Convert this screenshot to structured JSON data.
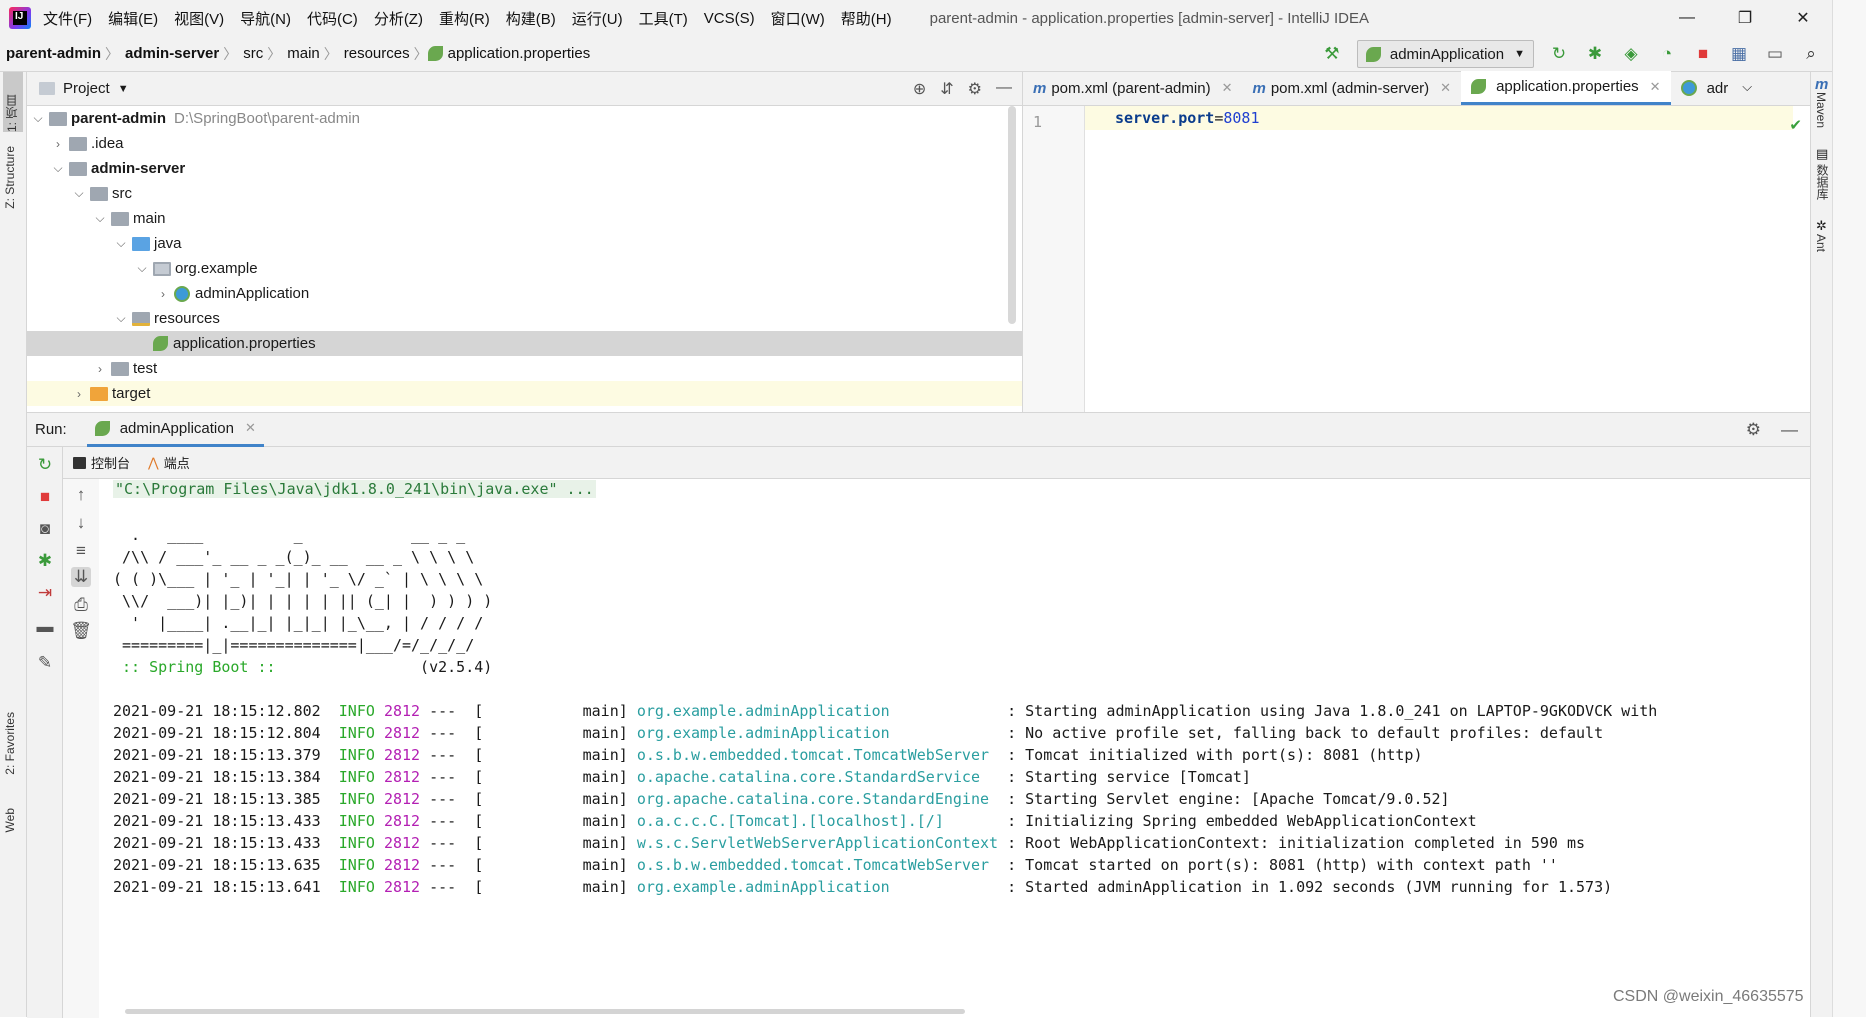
{
  "app": {
    "logo_text": "IJ",
    "menu": [
      "文件(F)",
      "编辑(E)",
      "视图(V)",
      "导航(N)",
      "代码(C)",
      "分析(Z)",
      "重构(R)",
      "构建(B)",
      "运行(U)",
      "工具(T)",
      "VCS(S)",
      "窗口(W)",
      "帮助(H)"
    ],
    "title": "parent-admin - application.properties [admin-server] - IntelliJ IDEA"
  },
  "breadcrumb": [
    "parent-admin",
    "admin-server",
    "src",
    "main",
    "resources",
    "application.properties"
  ],
  "run_config": "adminApplication",
  "left_strip": {
    "project_tab": "1: 项目",
    "structure_tab": "Z: Structure",
    "favorites_tab": "2: Favorites",
    "web_tab": "Web"
  },
  "right_strip": {
    "maven": "Maven",
    "database": "数据库",
    "ant": "Ant"
  },
  "project": {
    "header": "Project",
    "tree": [
      {
        "label": "parent-admin",
        "extra": "D:\\SpringBoot\\parent-admin",
        "bold": true
      },
      {
        "label": ".idea"
      },
      {
        "label": "admin-server",
        "bold": true
      },
      {
        "label": "src"
      },
      {
        "label": "main"
      },
      {
        "label": "java"
      },
      {
        "label": "org.example"
      },
      {
        "label": "adminApplication"
      },
      {
        "label": "resources"
      },
      {
        "label": "application.properties"
      },
      {
        "label": "test"
      },
      {
        "label": "target"
      }
    ]
  },
  "editor": {
    "tabs": [
      "pom.xml (parent-admin)",
      "pom.xml (admin-server)",
      "application.properties",
      "adr"
    ],
    "line_number": "1",
    "code": {
      "key": "server.port",
      "eq": "=",
      "value": "8081"
    }
  },
  "run": {
    "label": "Run:",
    "tab": "adminApplication",
    "subtabs": [
      "控制台",
      "端点"
    ],
    "command": "\"C:\\Program Files\\Java\\jdk1.8.0_241\\bin\\java.exe\" ...",
    "banner": [
      "  .   ____          _            __ _ _",
      " /\\\\ / ___'_ __ _ _(_)_ __  __ _ \\ \\ \\ \\",
      "( ( )\\___ | '_ | '_| | '_ \\/ _` | \\ \\ \\ \\",
      " \\\\/  ___)| |_)| | | | | || (_| |  ) ) ) )",
      "  '  |____| .__|_| |_|_| |_\\__, | / / / /",
      " =========|_|==============|___/=/_/_/_/"
    ],
    "spring_label": " :: Spring Boot :: ",
    "spring_version": "               (v2.5.4)",
    "logs": [
      {
        "ts": "2021-09-21 18:15:12.802",
        "level": "INFO",
        "pid": "2812",
        "thread": "---  [           main]",
        "logger": "org.example.adminApplication            ",
        "msg": ": Starting adminApplication using Java 1.8.0_241 on LAPTOP-9GKODVCK with"
      },
      {
        "ts": "2021-09-21 18:15:12.804",
        "level": "INFO",
        "pid": "2812",
        "thread": "---  [           main]",
        "logger": "org.example.adminApplication            ",
        "msg": ": No active profile set, falling back to default profiles: default"
      },
      {
        "ts": "2021-09-21 18:15:13.379",
        "level": "INFO",
        "pid": "2812",
        "thread": "---  [           main]",
        "logger": "o.s.b.w.embedded.tomcat.TomcatWebServer ",
        "msg": ": Tomcat initialized with port(s): 8081 (http)"
      },
      {
        "ts": "2021-09-21 18:15:13.384",
        "level": "INFO",
        "pid": "2812",
        "thread": "---  [           main]",
        "logger": "o.apache.catalina.core.StandardService  ",
        "msg": ": Starting service [Tomcat]"
      },
      {
        "ts": "2021-09-21 18:15:13.385",
        "level": "INFO",
        "pid": "2812",
        "thread": "---  [           main]",
        "logger": "org.apache.catalina.core.StandardEngine ",
        "msg": ": Starting Servlet engine: [Apache Tomcat/9.0.52]"
      },
      {
        "ts": "2021-09-21 18:15:13.433",
        "level": "INFO",
        "pid": "2812",
        "thread": "---  [           main]",
        "logger": "o.a.c.c.C.[Tomcat].[localhost].[/]      ",
        "msg": ": Initializing Spring embedded WebApplicationContext"
      },
      {
        "ts": "2021-09-21 18:15:13.433",
        "level": "INFO",
        "pid": "2812",
        "thread": "---  [           main]",
        "logger": "w.s.c.ServletWebServerApplicationContext",
        "msg": ": Root WebApplicationContext: initialization completed in 590 ms"
      },
      {
        "ts": "2021-09-21 18:15:13.635",
        "level": "INFO",
        "pid": "2812",
        "thread": "---  [           main]",
        "logger": "o.s.b.w.embedded.tomcat.TomcatWebServer ",
        "msg": ": Tomcat started on port(s): 8081 (http) with context path ''"
      },
      {
        "ts": "2021-09-21 18:15:13.641",
        "level": "INFO",
        "pid": "2812",
        "thread": "---  [           main]",
        "logger": "org.example.adminApplication            ",
        "msg": ": Started adminApplication in 1.092 seconds (JVM running for 1.573)"
      }
    ]
  },
  "watermark": "CSDN @weixin_46635575"
}
